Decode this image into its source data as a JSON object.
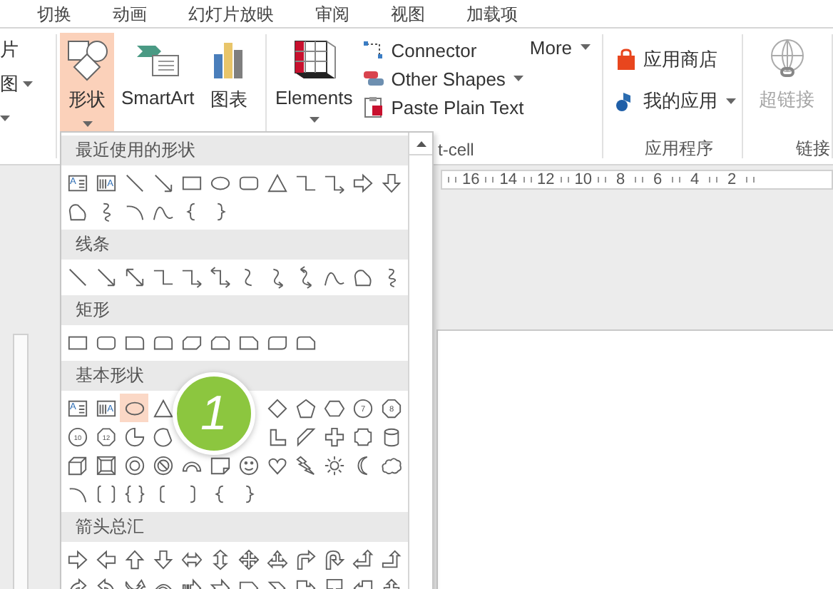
{
  "menu_tabs": [
    "切换",
    "动画",
    "幻灯片放映",
    "审阅",
    "视图",
    "加载项"
  ],
  "image_group": [
    {
      "label": "片",
      "dropdown": false
    },
    {
      "label": "图",
      "dropdown": true
    },
    {
      "dropdown": true
    }
  ],
  "illustrations": [
    {
      "kind": "shapes",
      "label": "形状",
      "dropdown": true,
      "selected": true
    },
    {
      "kind": "smartart",
      "label": "SmartArt",
      "dropdown": false,
      "selected": false
    },
    {
      "kind": "chart",
      "label": "图表",
      "dropdown": false,
      "selected": false
    }
  ],
  "addin_group": {
    "large": {
      "kind": "elements",
      "label": "Elements",
      "dropdown": true
    },
    "commands": [
      {
        "kind": "connector",
        "label": "Connector",
        "dropdown": false
      },
      {
        "kind": "other-shapes",
        "label": "Other Shapes",
        "dropdown": true
      },
      {
        "kind": "paste-text",
        "label": "Paste Plain Text",
        "dropdown": false
      }
    ],
    "more": {
      "label": "More",
      "dropdown": true
    },
    "group_label": "t-cell"
  },
  "apps_group": {
    "commands": [
      {
        "kind": "store",
        "label": "应用商店",
        "dropdown": false
      },
      {
        "kind": "my-apps",
        "label": "我的应用",
        "dropdown": true
      }
    ],
    "group_label": "应用程序"
  },
  "links_group": {
    "button": {
      "kind": "hyperlink",
      "label": "超链接",
      "disabled": true
    },
    "group_label": "链接"
  },
  "ruler": {
    "labels": [
      "16",
      "14",
      "12",
      "10",
      "8",
      "6",
      "4",
      "2"
    ]
  },
  "shapes_gallery": {
    "sections": [
      {
        "title": "最近使用的形状",
        "shapes": [
          {
            "kind": "textbox",
            "label": "A",
            "selected": false
          },
          {
            "kind": "vtextbox",
            "label": "A",
            "selected": false
          },
          {
            "kind": "line",
            "selected": false
          },
          {
            "kind": "arrow-line",
            "selected": false
          },
          {
            "kind": "rectangle",
            "selected": false
          },
          {
            "kind": "oval",
            "selected": false
          },
          {
            "kind": "rounded-rectangle",
            "selected": false
          },
          {
            "kind": "triangle",
            "selected": false
          },
          {
            "kind": "elbow",
            "selected": false
          },
          {
            "kind": "elbow-arrow",
            "selected": false
          },
          {
            "kind": "right-arrow",
            "selected": false
          },
          {
            "kind": "down-arrow",
            "selected": false
          },
          {
            "kind": "freeform",
            "selected": false
          },
          {
            "kind": "scribble",
            "selected": false
          },
          {
            "kind": "arc",
            "selected": false
          },
          {
            "kind": "curve",
            "selected": false
          },
          {
            "kind": "left-brace",
            "selected": false
          },
          {
            "kind": "right-brace",
            "selected": false
          }
        ]
      },
      {
        "title": "线条",
        "shapes": [
          {
            "kind": "line",
            "selected": false
          },
          {
            "kind": "arrow-line",
            "selected": false
          },
          {
            "kind": "double-arrow-line",
            "selected": false
          },
          {
            "kind": "elbow",
            "selected": false
          },
          {
            "kind": "elbow-arrow",
            "selected": false
          },
          {
            "kind": "elbow-double-arrow",
            "selected": false
          },
          {
            "kind": "curved-connector",
            "selected": false
          },
          {
            "kind": "curved-arrow",
            "selected": false
          },
          {
            "kind": "curved-double-arrow",
            "selected": false
          },
          {
            "kind": "curve",
            "selected": false
          },
          {
            "kind": "freeform",
            "selected": false
          },
          {
            "kind": "scribble",
            "selected": false
          }
        ]
      },
      {
        "title": "矩形",
        "shapes": [
          {
            "kind": "rectangle",
            "selected": false
          },
          {
            "kind": "rounded-rectangle",
            "selected": false
          },
          {
            "kind": "round-single",
            "selected": false
          },
          {
            "kind": "round-same-side",
            "selected": false
          },
          {
            "kind": "snip-diagonal",
            "selected": false
          },
          {
            "kind": "snip-same-side",
            "selected": false
          },
          {
            "kind": "snip-rectangle",
            "selected": false
          },
          {
            "kind": "round-diagonal",
            "selected": false
          },
          {
            "kind": "snip-round",
            "selected": false
          }
        ]
      },
      {
        "title": "基本形状",
        "shapes": [
          {
            "kind": "textbox",
            "label": "A",
            "selected": false
          },
          {
            "kind": "vtextbox",
            "label": "A",
            "selected": false
          },
          {
            "kind": "oval",
            "selected": true
          },
          {
            "kind": "triangle",
            "selected": false
          },
          {
            "kind": "covered"
          },
          {
            "kind": "covered"
          },
          {
            "kind": "covered"
          },
          {
            "kind": "diamond",
            "selected": false
          },
          {
            "kind": "pentagon",
            "selected": false
          },
          {
            "kind": "hexagon",
            "selected": false
          },
          {
            "kind": "heptagon",
            "label": "7",
            "selected": false
          },
          {
            "kind": "octagon",
            "label": "8",
            "selected": false
          },
          {
            "kind": "decagon",
            "label": "10",
            "selected": false
          },
          {
            "kind": "dodecagon",
            "label": "12",
            "selected": false
          },
          {
            "kind": "pie",
            "selected": false
          },
          {
            "kind": "chord",
            "selected": false
          },
          {
            "kind": "covered"
          },
          {
            "kind": "covered"
          },
          {
            "kind": "covered"
          },
          {
            "kind": "l-shape",
            "selected": false
          },
          {
            "kind": "diagonal-stripe",
            "selected": false
          },
          {
            "kind": "plus",
            "selected": false
          },
          {
            "kind": "plaque",
            "selected": false
          },
          {
            "kind": "can",
            "selected": false
          },
          {
            "kind": "cube",
            "selected": false
          },
          {
            "kind": "bevel",
            "selected": false
          },
          {
            "kind": "donut",
            "selected": false
          },
          {
            "kind": "no-symbol",
            "selected": false
          },
          {
            "kind": "block-arc",
            "selected": false
          },
          {
            "kind": "folded-corner",
            "selected": false
          },
          {
            "kind": "smiley",
            "selected": false
          },
          {
            "kind": "heart",
            "selected": false
          },
          {
            "kind": "lightning",
            "selected": false
          },
          {
            "kind": "sun",
            "selected": false
          },
          {
            "kind": "moon",
            "selected": false
          },
          {
            "kind": "cloud",
            "selected": false
          },
          {
            "kind": "arc",
            "selected": false
          },
          {
            "kind": "bracket-pair",
            "selected": false
          },
          {
            "kind": "brace-pair",
            "selected": false
          },
          {
            "kind": "left-bracket",
            "selected": false
          },
          {
            "kind": "right-bracket",
            "selected": false
          },
          {
            "kind": "left-brace",
            "selected": false
          },
          {
            "kind": "right-brace",
            "selected": false
          }
        ]
      },
      {
        "title": "箭头总汇",
        "shapes": [
          {
            "kind": "right-arrow",
            "selected": false
          },
          {
            "kind": "left-arrow",
            "selected": false
          },
          {
            "kind": "up-arrow",
            "selected": false
          },
          {
            "kind": "down-arrow",
            "selected": false
          },
          {
            "kind": "left-right-arrow",
            "selected": false
          },
          {
            "kind": "up-down-arrow",
            "selected": false
          },
          {
            "kind": "quad-arrow",
            "selected": false
          },
          {
            "kind": "left-right-up-arrow",
            "selected": false
          },
          {
            "kind": "bent-arrow",
            "selected": false
          },
          {
            "kind": "u-turn-arrow",
            "selected": false
          },
          {
            "kind": "left-up-arrow",
            "selected": false
          },
          {
            "kind": "bent-up-arrow",
            "selected": false
          },
          {
            "kind": "curved-right-arrow",
            "selected": false
          },
          {
            "kind": "curved-left-arrow",
            "selected": false
          },
          {
            "kind": "curved-up-arrow",
            "selected": false
          },
          {
            "kind": "curved-down-arrow",
            "selected": false
          },
          {
            "kind": "striped-right-arrow",
            "selected": false
          },
          {
            "kind": "notched-right-arrow",
            "selected": false
          },
          {
            "kind": "pentagon-arrow",
            "selected": false
          },
          {
            "kind": "chevron",
            "selected": false
          },
          {
            "kind": "right-callout",
            "selected": false
          },
          {
            "kind": "down-callout",
            "selected": false
          },
          {
            "kind": "left-callout",
            "selected": false
          },
          {
            "kind": "up-callout",
            "selected": false
          }
        ]
      }
    ]
  },
  "callout": {
    "label": "1"
  }
}
